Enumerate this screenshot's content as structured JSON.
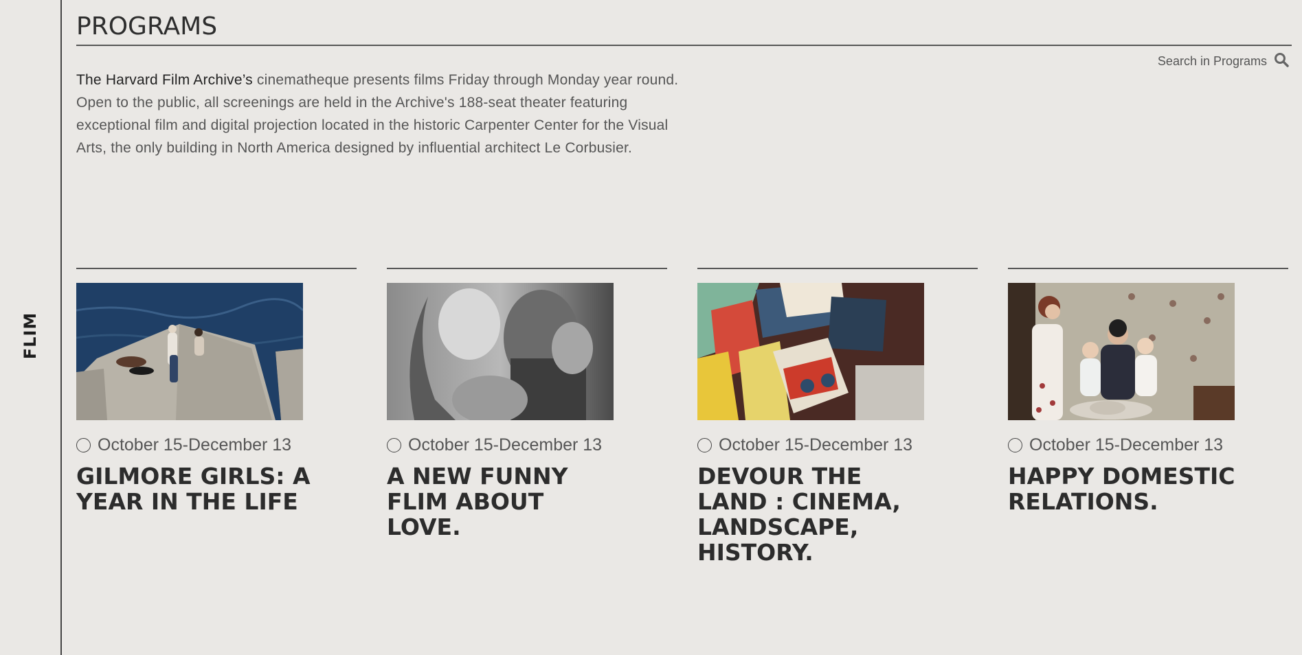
{
  "sidebar": {
    "label": "FLIM"
  },
  "header": {
    "title": "PROGRAMS",
    "search_label": "Search in Programs",
    "search_icon": "search-icon"
  },
  "intro": {
    "highlight": "The Harvard Film Archive’s",
    "text": " cinematheque presents films Friday through Monday year round. Open to the public, all screenings are held in the Archive's 188-seat theater featuring exceptional film and digital projection located in the historic Carpenter Center for the Visual Arts, the only building in North America designed by influential architect Le Corbusier."
  },
  "programs": [
    {
      "date": "October 15-December 13",
      "title": "GILMORE GIRLS: A YEAR IN THE LIFE",
      "date_icon": "clock-icon"
    },
    {
      "date": "October 15-December 13",
      "title": "A NEW FUNNY FLIM ABOUT LOVE.",
      "date_icon": "clock-icon"
    },
    {
      "date": "October 15-December 13",
      "title": "DEVOUR THE LAND : CINEMA, LANDSCAPE, HISTORY.",
      "date_icon": "clock-icon"
    },
    {
      "date": "October 15-December 13",
      "title": "HAPPY DOMESTIC RELATIONS.",
      "date_icon": "clock-icon"
    }
  ]
}
